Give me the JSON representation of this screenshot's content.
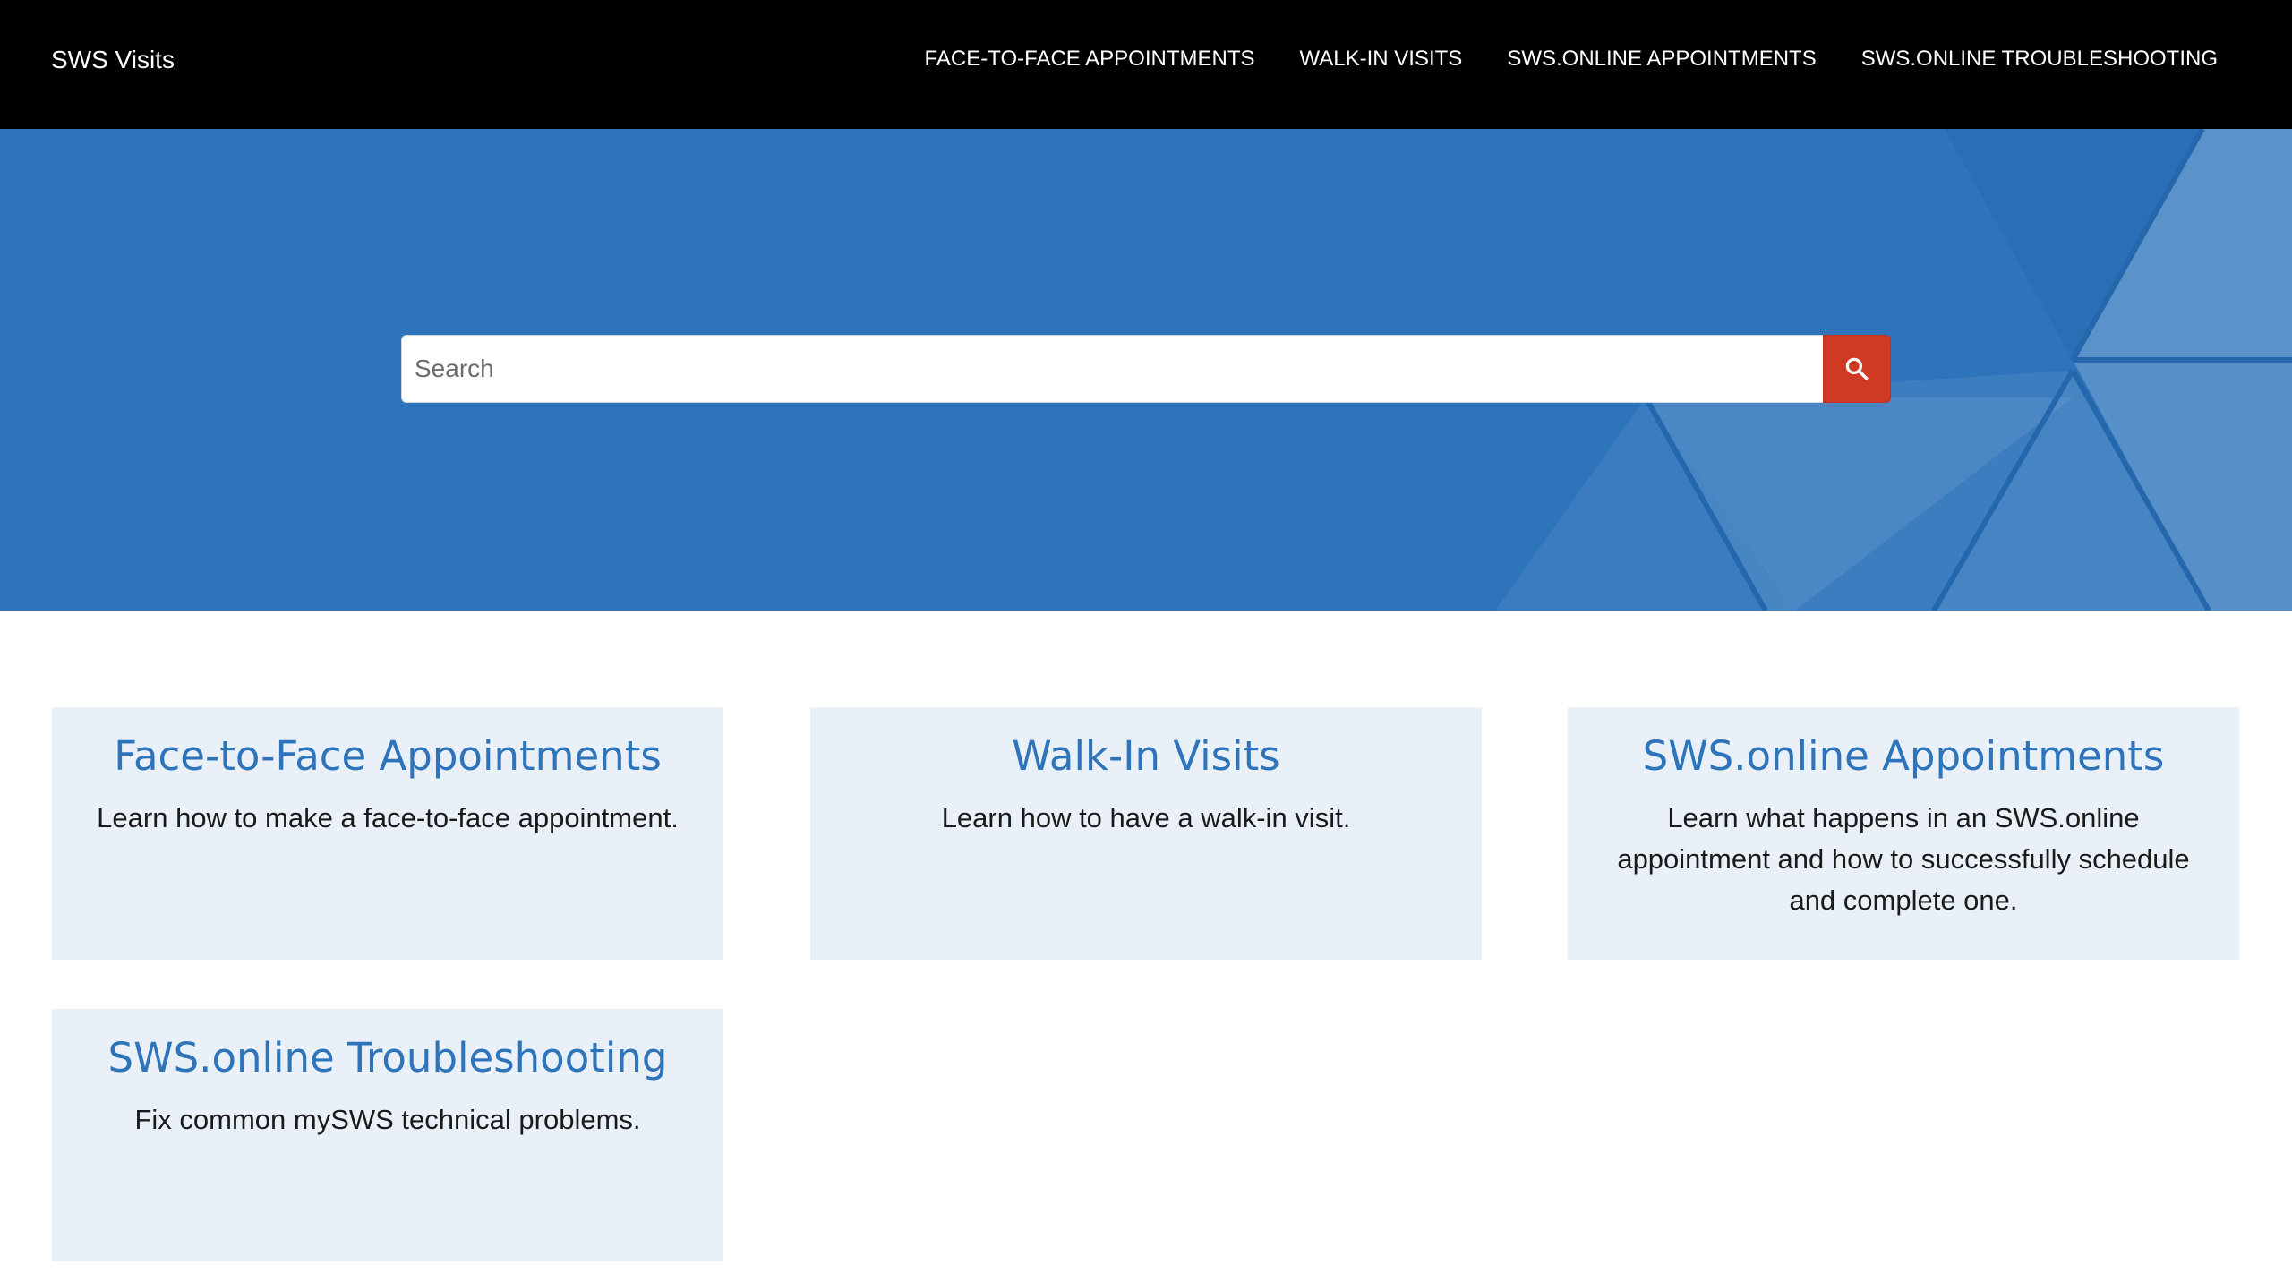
{
  "header": {
    "site_title": "SWS Visits",
    "nav": [
      {
        "label": "FACE-TO-FACE APPOINTMENTS"
      },
      {
        "label": "WALK-IN VISITS"
      },
      {
        "label": "SWS.ONLINE APPOINTMENTS"
      },
      {
        "label": "SWS.ONLINE TROUBLESHOOTING"
      }
    ]
  },
  "hero": {
    "search": {
      "placeholder": "Search",
      "value": "",
      "button_icon": "search-icon"
    }
  },
  "cards": [
    {
      "title": "Face-to-Face Appointments",
      "description": "Learn how to make a face-to-face appointment."
    },
    {
      "title": "Walk-In Visits",
      "description": "Learn how to have a walk-in visit."
    },
    {
      "title": "SWS.online Appointments",
      "description": "Learn what happens in an SWS.online appointment and how to successfully schedule and complete one."
    },
    {
      "title": "SWS.online Troubleshooting",
      "description": "Fix common mySWS technical problems."
    }
  ],
  "colors": {
    "header_bg": "#000000",
    "hero_bg": "#2e74bb",
    "accent_link": "#2e74bb",
    "search_button": "#cf3a24",
    "card_bg": "#eaf0f8"
  }
}
